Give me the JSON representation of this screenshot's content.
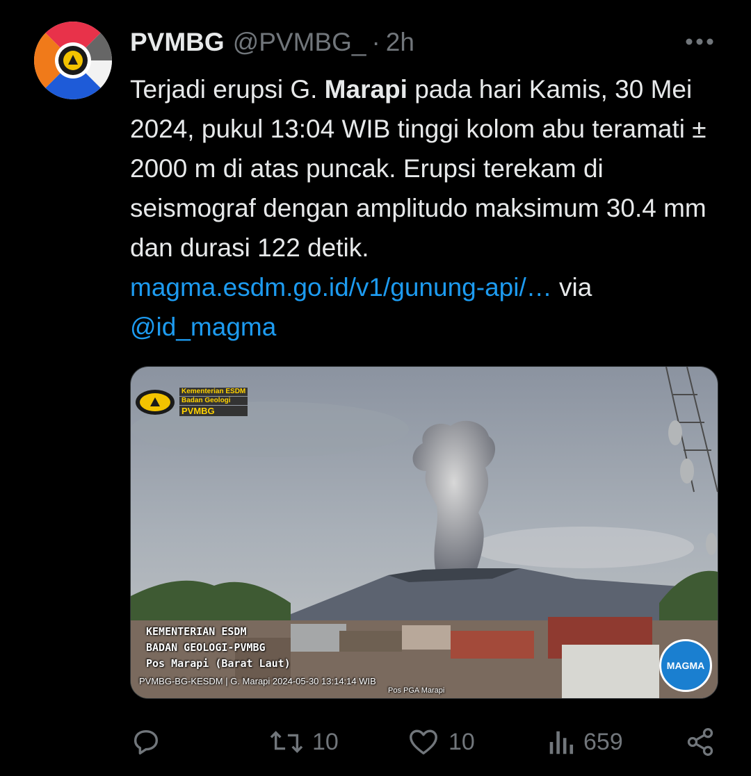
{
  "author": {
    "name": "PVMBG",
    "handle": "@PVMBG_",
    "separator": "·",
    "time": "2h",
    "avatar_icon": "pvmbg-logo-icon"
  },
  "tweet": {
    "text_part1": "Terjadi erupsi G. ",
    "bold_word": "Marapi",
    "text_part2": " pada hari Kamis, 30 Mei 2024, pukul 13:04 WIB tinggi kolom abu teramati ± 2000 m di atas puncak. Erupsi terekam di seismograf dengan amplitudo maksimum 30.4 mm dan durasi 122 detik. ",
    "link_text": "magma.esdm.go.id/v1/gunung-api/…",
    "via_text": " via ",
    "mention": "@id_magma"
  },
  "media": {
    "logo_line1": "Kementerian ESDM",
    "logo_line2": "Badan Geologi",
    "logo_line3": "PVMBG",
    "overlay_line1": "KEMENTERIAN ESDM",
    "overlay_line2": "BADAN GEOLOGI-PVMBG",
    "overlay_line3": "Pos Marapi (Barat Laut)",
    "stamp": "PVMBG-BG-KESDM | G. Marapi 2024-05-30 13:14:14 WIB",
    "pos_label": "Pos PGA Marapi",
    "badge_text": "MAGMA"
  },
  "actions": {
    "reply": {
      "icon": "reply-icon"
    },
    "retweet": {
      "icon": "retweet-icon",
      "count": "10"
    },
    "like": {
      "icon": "heart-icon",
      "count": "10"
    },
    "views": {
      "icon": "views-icon",
      "count": "659"
    },
    "share": {
      "icon": "share-icon"
    }
  },
  "colors": {
    "background": "#000000",
    "text": "#e7e9ea",
    "muted": "#71767b",
    "link": "#1d9bf0"
  }
}
